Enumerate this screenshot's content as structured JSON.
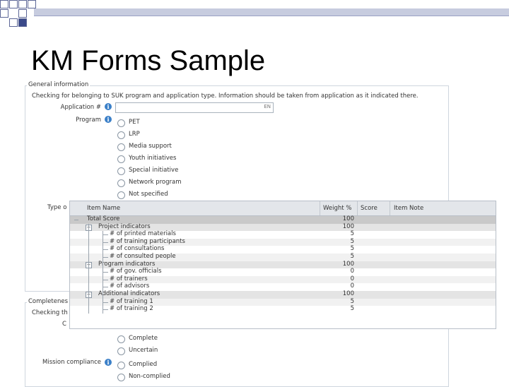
{
  "slide": {
    "title": "KM Forms Sample"
  },
  "form": {
    "general_info": {
      "legend": "General information",
      "description": "Checking for belonging to SUK program and application type. Information should be taken from application as it indicated there.",
      "application_label": "Application #",
      "application_value": "",
      "application_suffix": "EN",
      "program_label": "Program",
      "program_options": [
        "PET",
        "LRP",
        "Media support",
        "Youth initiatives",
        "Special initiative",
        "Network program",
        "Not specified"
      ],
      "type_label_partial": "Type o"
    },
    "completeness": {
      "legend_partial": "Completenes",
      "checking_partial": "Checking th",
      "sub_partial": "C",
      "options": [
        "Complete",
        "Uncertain"
      ],
      "mission_label": "Mission compliance",
      "mission_options": [
        "Complied",
        "Non-complied"
      ]
    }
  },
  "grid": {
    "columns": [
      "Item Name",
      "Weight %",
      "Score",
      "Item Note"
    ],
    "rows": [
      {
        "name": "Total Score",
        "weight": "100",
        "level": 0,
        "kind": "total"
      },
      {
        "name": "Project indicators",
        "weight": "100",
        "level": 1,
        "kind": "group"
      },
      {
        "name": "# of printed materials",
        "weight": "5",
        "level": 2,
        "kind": "item"
      },
      {
        "name": "# of training participants",
        "weight": "5",
        "level": 2,
        "kind": "item"
      },
      {
        "name": "# of consultations",
        "weight": "5",
        "level": 2,
        "kind": "item"
      },
      {
        "name": "# of consulted people",
        "weight": "5",
        "level": 2,
        "kind": "item"
      },
      {
        "name": "Program indicators",
        "weight": "100",
        "level": 1,
        "kind": "group"
      },
      {
        "name": "# of gov. officials",
        "weight": "0",
        "level": 2,
        "kind": "item"
      },
      {
        "name": "# of trainers",
        "weight": "0",
        "level": 2,
        "kind": "item"
      },
      {
        "name": "# of advisors",
        "weight": "0",
        "level": 2,
        "kind": "item"
      },
      {
        "name": "Additional indicators",
        "weight": "100",
        "level": 1,
        "kind": "group"
      },
      {
        "name": "# of training 1",
        "weight": "5",
        "level": 2,
        "kind": "item"
      },
      {
        "name": "# of training 2",
        "weight": "5",
        "level": 2,
        "kind": "item"
      }
    ]
  },
  "colors": {
    "info_icon": "#3a7fc8",
    "grid_header": "#e3e6ea",
    "total_row": "#c9c9c9",
    "group_row": "#e4e4e4"
  }
}
